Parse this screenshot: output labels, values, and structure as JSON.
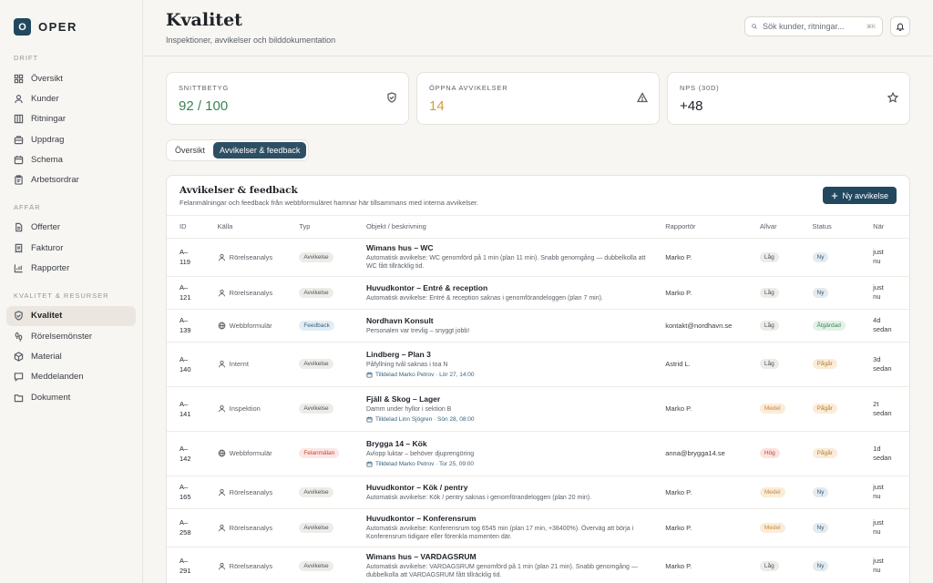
{
  "brand": {
    "logo_letter": "O",
    "name": "OPER"
  },
  "sidebar": {
    "sections": [
      {
        "label": "DRIFT",
        "items": [
          {
            "label": "Översikt",
            "icon": "grid-icon"
          },
          {
            "label": "Kunder",
            "icon": "users-icon"
          },
          {
            "label": "Ritningar",
            "icon": "blueprint-icon"
          },
          {
            "label": "Uppdrag",
            "icon": "briefcase-icon"
          },
          {
            "label": "Schema",
            "icon": "calendar-icon"
          },
          {
            "label": "Arbetsordrar",
            "icon": "clipboard-icon"
          }
        ]
      },
      {
        "label": "AFFÄR",
        "items": [
          {
            "label": "Offerter",
            "icon": "document-icon"
          },
          {
            "label": "Fakturor",
            "icon": "receipt-icon"
          },
          {
            "label": "Rapporter",
            "icon": "chart-icon"
          }
        ]
      },
      {
        "label": "KVALITET & RESURSER",
        "items": [
          {
            "label": "Kvalitet",
            "icon": "shield-check-icon",
            "active": true
          },
          {
            "label": "Rörelsemönster",
            "icon": "footprints-icon"
          },
          {
            "label": "Material",
            "icon": "box-icon"
          },
          {
            "label": "Meddelanden",
            "icon": "message-icon"
          },
          {
            "label": "Dokument",
            "icon": "folder-icon"
          }
        ]
      }
    ]
  },
  "header": {
    "title": "Kvalitet",
    "subtitle": "Inspektioner, avvikelser och bilddokumentation",
    "search_placeholder": "Sök kunder, ritningar...",
    "search_shortcut": "⌘K"
  },
  "stats": [
    {
      "label": "SNITTBETYG",
      "value": "92 / 100",
      "color": "#3b8457",
      "icon": "shield-check-icon"
    },
    {
      "label": "ÖPPNA AVVIKELSER",
      "value": "14",
      "color": "#d69a3c",
      "icon": "warning-icon"
    },
    {
      "label": "NPS (30D)",
      "value": "+48",
      "color": "#1f2328",
      "icon": "star-icon"
    }
  ],
  "tabs": [
    {
      "label": "Översikt",
      "active": false
    },
    {
      "label": "Avvikelser & feedback",
      "active": true
    }
  ],
  "card": {
    "title": "Avvikelser & feedback",
    "subtitle": "Felanmälningar och feedback från webbformuläret hamnar här tillsammans med interna avvikelser.",
    "new_button": "Ny avvikelse"
  },
  "table": {
    "headers": [
      "ID",
      "Källa",
      "Typ",
      "Objekt / beskrivning",
      "Rapportör",
      "Allvar",
      "Status",
      "När"
    ],
    "rows": [
      {
        "id": [
          "A–",
          "119"
        ],
        "source": "Rörelseanalys",
        "source_icon": "person-icon",
        "type": "Avvikelse",
        "title": "Wimans hus – WC",
        "desc": "Automatisk avvikelse: WC genomförd på 1 min (plan 11 min). Snabb genomgång — dubbelkolla att WC fått tillräcklig tid.",
        "assigned": "",
        "reporter": "Marko P.",
        "severity": "Låg",
        "status": "Ny",
        "when": [
          "just",
          "nu"
        ]
      },
      {
        "id": [
          "A–",
          "121"
        ],
        "source": "Rörelseanalys",
        "source_icon": "person-icon",
        "type": "Avvikelse",
        "title": "Huvudkontor – Entré & reception",
        "desc": "Automatisk avvikelse: Entré & reception saknas i genomförandeloggen (plan 7 min).",
        "assigned": "",
        "reporter": "Marko P.",
        "severity": "Låg",
        "status": "Ny",
        "when": [
          "just",
          "nu"
        ]
      },
      {
        "id": [
          "A–",
          "139"
        ],
        "source": "Webbformulär",
        "source_icon": "globe-icon",
        "type": "Feedback",
        "title": "Nordhavn Konsult",
        "desc": "Personalen var trevlig – snyggt jobb!",
        "assigned": "",
        "reporter": "kontakt@nordhavn.se",
        "severity": "Låg",
        "status": "Åtgärdad",
        "when": [
          "4d",
          "sedan"
        ]
      },
      {
        "id": [
          "A–",
          "140"
        ],
        "source": "Internt",
        "source_icon": "person-icon",
        "type": "Avvikelse",
        "title": "Lindberg – Plan 3",
        "desc": "Påfyllning tvål saknas i toa N",
        "assigned": "Tilldelad Marko Petrov · Lör 27, 14:00",
        "reporter": "Astrid L.",
        "severity": "Låg",
        "status": "Pågår",
        "when": [
          "3d",
          "sedan"
        ]
      },
      {
        "id": [
          "A–",
          "141"
        ],
        "source": "Inspektion",
        "source_icon": "person-icon",
        "type": "Avvikelse",
        "title": "Fjäll & Skog – Lager",
        "desc": "Damm under hyllor i sektion B",
        "assigned": "Tilldelad Linn Sjögren · Sön 28, 08:00",
        "reporter": "Marko P.",
        "severity": "Medel",
        "status": "Pågår",
        "when": [
          "2t",
          "sedan"
        ]
      },
      {
        "id": [
          "A–",
          "142"
        ],
        "source": "Webbformulär",
        "source_icon": "globe-icon",
        "type": "Felanmälan",
        "title": "Brygga 14 – Kök",
        "desc": "Avlopp luktar – behöver djuprengöring",
        "assigned": "Tilldelad Marko Petrov · Tor 25, 09:00",
        "reporter": "anna@brygga14.se",
        "severity": "Hög",
        "status": "Pågår",
        "when": [
          "1d",
          "sedan"
        ]
      },
      {
        "id": [
          "A–",
          "165"
        ],
        "source": "Rörelseanalys",
        "source_icon": "person-icon",
        "type": "Avvikelse",
        "title": "Huvudkontor – Kök / pentry",
        "desc": "Automatisk avvikelse: Kök / pentry saknas i genomförandeloggen (plan 20 min).",
        "assigned": "",
        "reporter": "Marko P.",
        "severity": "Medel",
        "status": "Ny",
        "when": [
          "just",
          "nu"
        ]
      },
      {
        "id": [
          "A–",
          "258"
        ],
        "source": "Rörelseanalys",
        "source_icon": "person-icon",
        "type": "Avvikelse",
        "title": "Huvudkontor – Konferensrum",
        "desc": "Automatisk avvikelse: Konferensrum tog 6545 min (plan 17 min, +38400%). Överväg att börja i Konferensrum tidigare eller förenkla momenten där.",
        "assigned": "",
        "reporter": "Marko P.",
        "severity": "Medel",
        "status": "Ny",
        "when": [
          "just",
          "nu"
        ]
      },
      {
        "id": [
          "A–",
          "291"
        ],
        "source": "Rörelseanalys",
        "source_icon": "person-icon",
        "type": "Avvikelse",
        "title": "Wimans hus – VARDAGSRUM",
        "desc": "Automatisk avvikelse: VARDAGSRUM genomförd på 1 min (plan 21 min). Snabb genomgång — dubbelkolla att VARDAGSRUM fått tillräcklig tid.",
        "assigned": "",
        "reporter": "Marko P.",
        "severity": "Låg",
        "status": "Ny",
        "when": [
          "just",
          "nu"
        ]
      }
    ]
  }
}
